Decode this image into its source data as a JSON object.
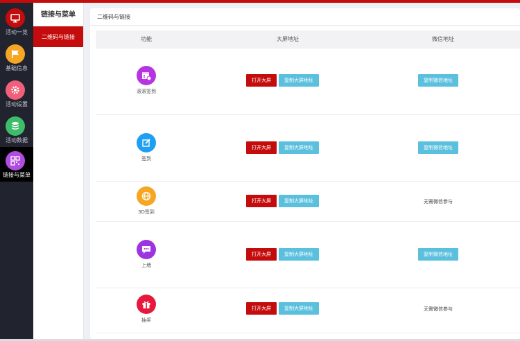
{
  "colors": {
    "accent": "#c40c0c",
    "blue_button": "#5bc0de",
    "rail_bg": "#21232f"
  },
  "rail": {
    "items": [
      {
        "label": "活动一览",
        "icon": "monitor-icon",
        "color": "#c40c0c"
      },
      {
        "label": "基础信息",
        "icon": "flag-icon",
        "color": "#f5a623"
      },
      {
        "label": "活动设置",
        "icon": "gear-icon",
        "color": "#f0607a"
      },
      {
        "label": "活动数据",
        "icon": "database-icon",
        "color": "#3dbd6a"
      },
      {
        "label": "链接与菜单",
        "icon": "qrcode-icon",
        "color": "#b04ce0"
      }
    ]
  },
  "submenu": {
    "title": "链接与菜单",
    "active_item": "二维码与链接"
  },
  "panel": {
    "title": "二维码与链接"
  },
  "table": {
    "headers": [
      "功能",
      "大屏地址",
      "微信地址"
    ],
    "open_label": "打开大屏",
    "copy_screen_label": "复制大屏地址",
    "copy_wechat_label": "复制微信地址",
    "no_wechat_label": "无需微信参与",
    "rows": [
      {
        "name": "滚滚签到",
        "icon": "calendar-checkin-icon",
        "color": "#b735e0",
        "wechat": true
      },
      {
        "name": "签到",
        "icon": "edit-icon",
        "color": "#1e9ff2",
        "wechat": true
      },
      {
        "name": "3D签到",
        "icon": "globe-icon",
        "color": "#f5a623",
        "wechat": false
      },
      {
        "name": "上墙",
        "icon": "chat-icon",
        "color": "#9c35e0",
        "wechat": true
      },
      {
        "name": "抽奖",
        "icon": "gift-icon",
        "color": "#e8183c",
        "wechat": false
      }
    ]
  }
}
